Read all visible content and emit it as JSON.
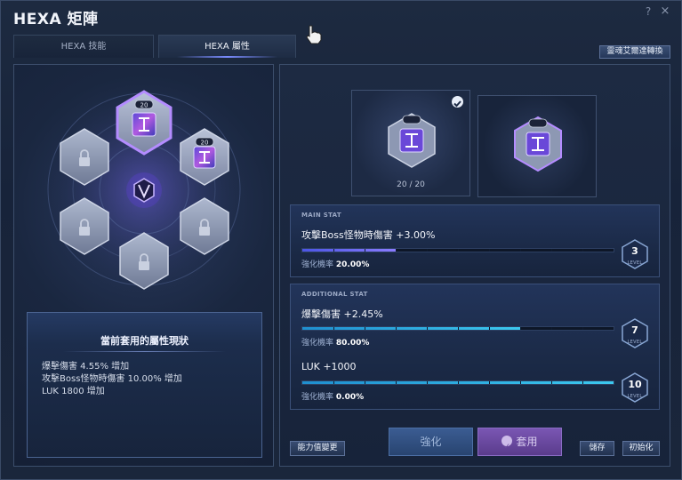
{
  "window": {
    "title": "HEXA 矩陣",
    "help_label": "?",
    "close_label": "×"
  },
  "tabs": [
    {
      "label": "HEXA 技能",
      "active": false
    },
    {
      "label": "HEXA 屬性",
      "active": true
    }
  ],
  "transfer_button": "靈魂艾爾達轉換",
  "hex_grid": {
    "active_level_badges": [
      "20",
      "20"
    ],
    "locked_slots": 4,
    "center_icon": "v-matrix-icon"
  },
  "current_status": {
    "title": "當前套用的屬性現狀",
    "lines": [
      "爆擊傷害 4.55% 增加",
      "攻擊Boss怪物時傷害 10.00% 增加",
      "LUK 1800 增加"
    ]
  },
  "slots": {
    "slot_a": {
      "count": "20 / 20",
      "selected": true
    },
    "slot_b": {
      "selected": false
    }
  },
  "main_stat": {
    "header": "MAIN STAT",
    "name": "攻擊Boss怪物時傷害 +3.00%",
    "rate_label": "強化機率",
    "rate_value": "20.00%",
    "level": "3",
    "level_label": "LEVEL",
    "progress": 0.3
  },
  "additional_stats": {
    "header": "ADDITIONAL STAT",
    "items": [
      {
        "name": "爆擊傷害 +2.45%",
        "rate_label": "強化機率",
        "rate_value": "80.00%",
        "level": "7",
        "level_label": "LEVEL",
        "progress": 0.7
      },
      {
        "name": "LUK +1000",
        "rate_label": "強化機率",
        "rate_value": "0.00%",
        "level": "10",
        "level_label": "LEVEL",
        "progress": 1.0
      }
    ]
  },
  "buttons": {
    "change": "能力值變更",
    "enhance": "強化",
    "apply": "套用",
    "save": "儲存",
    "reset": "初始化"
  },
  "colors": {
    "accent_purple": "#8a5cf0",
    "bar_blue": "#2fb6e0",
    "bar_purple": "#6f62ff"
  }
}
